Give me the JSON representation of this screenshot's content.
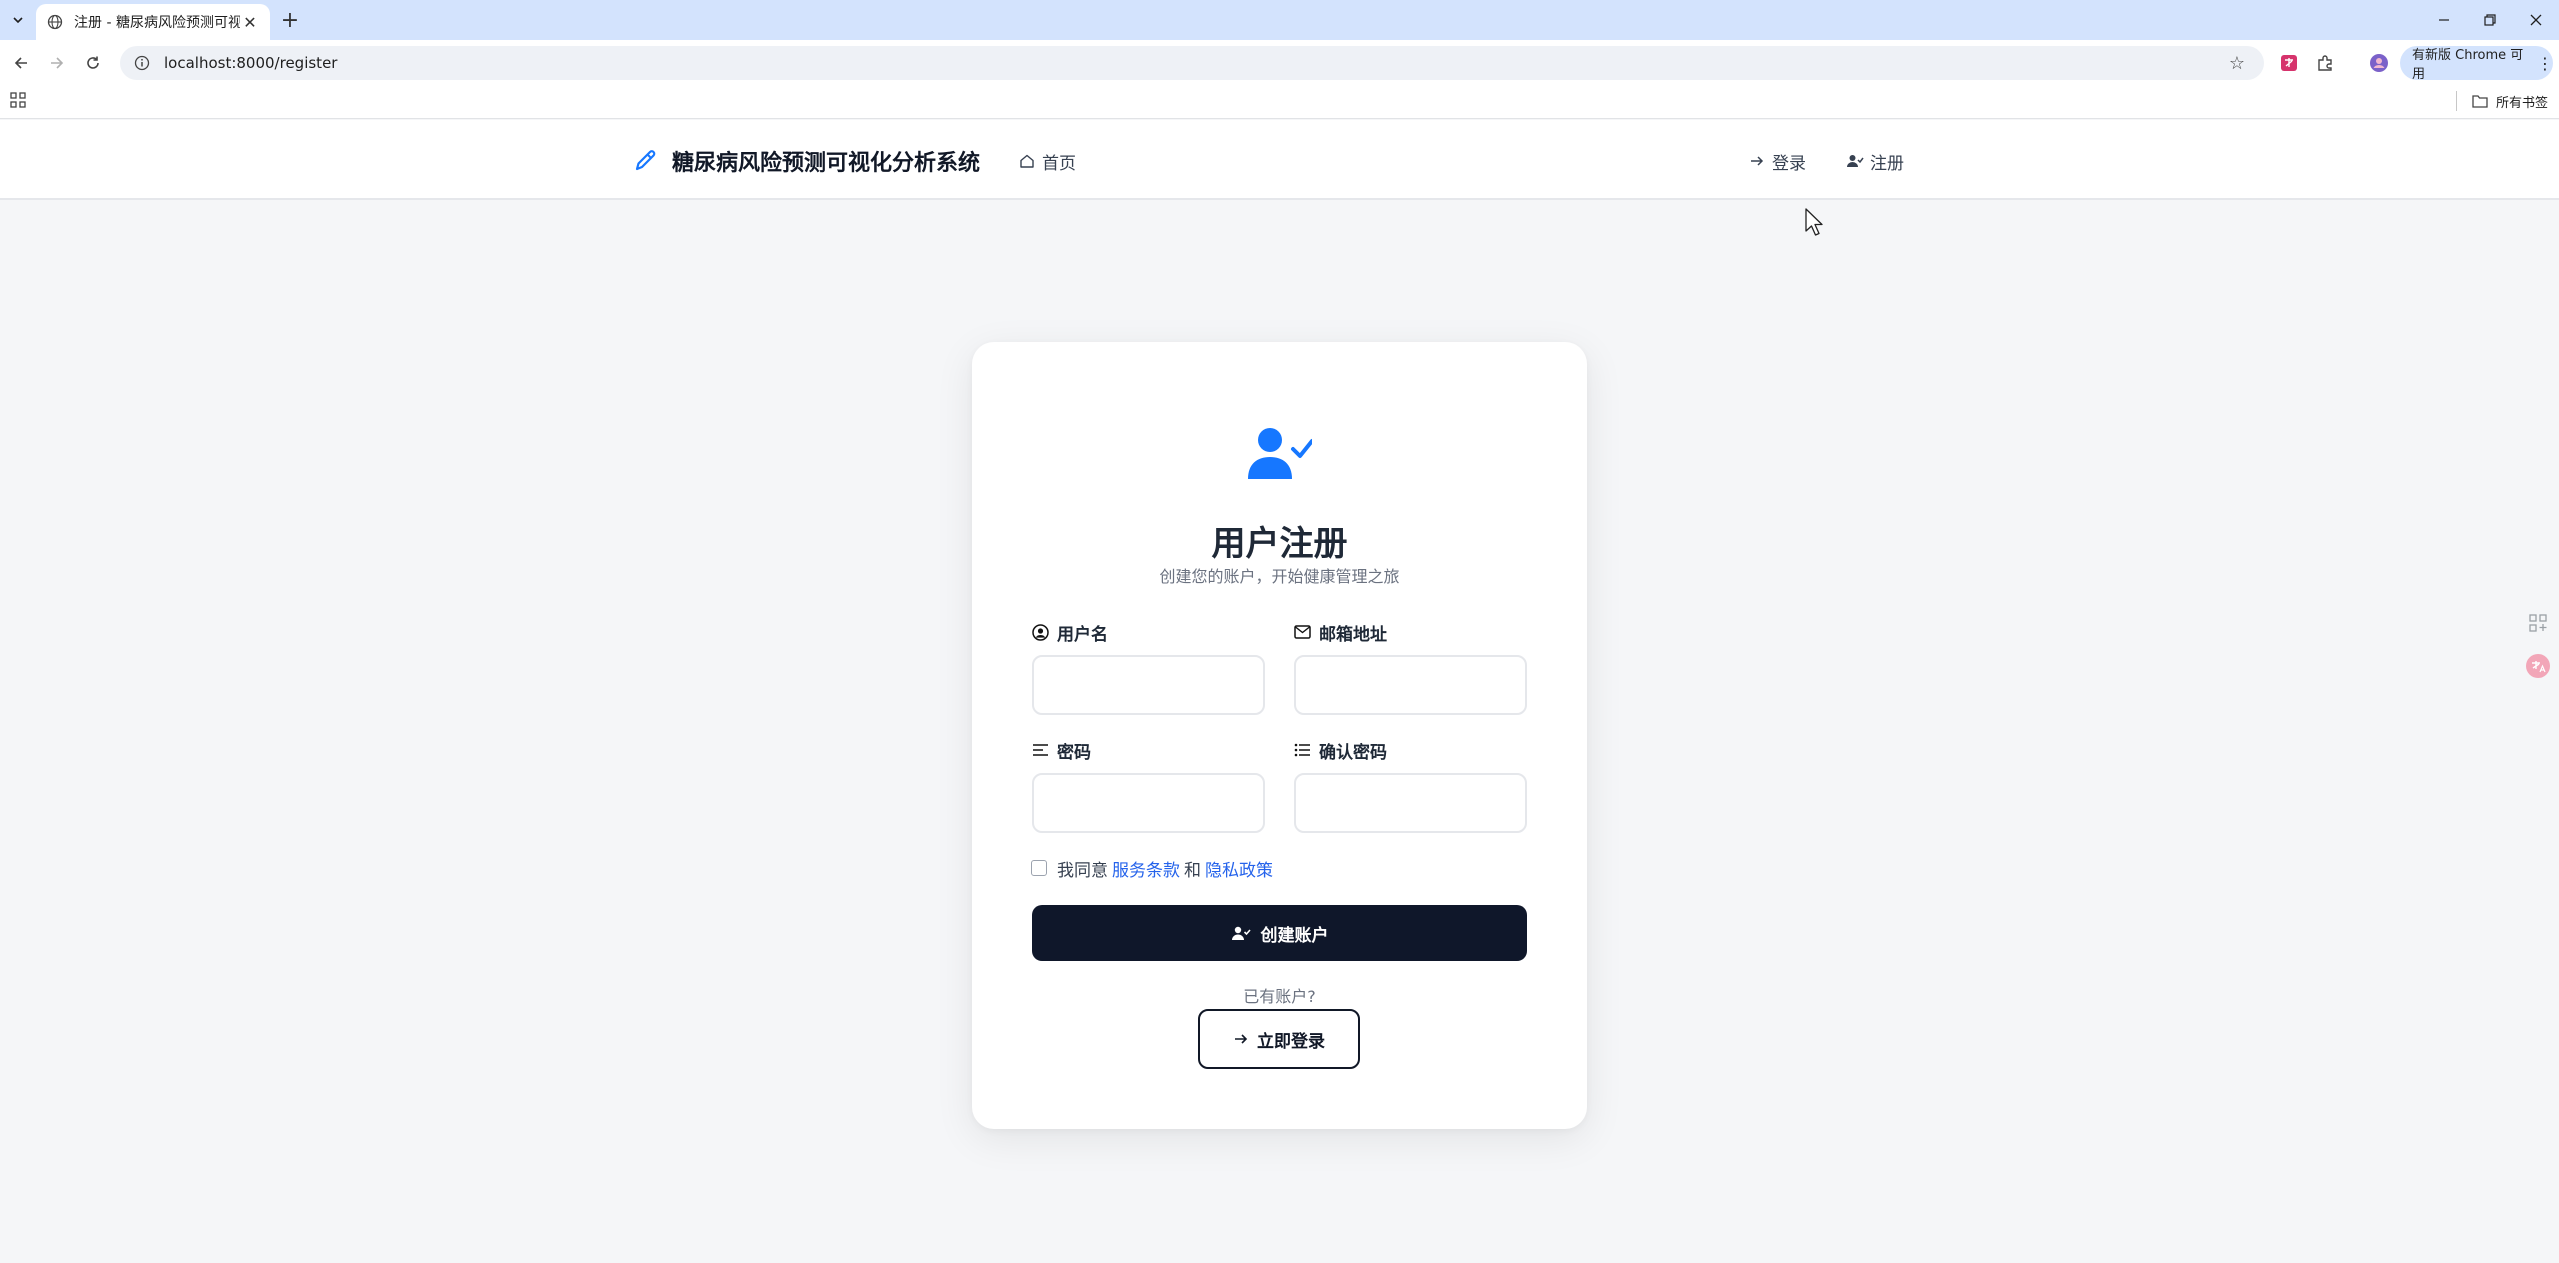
{
  "browser": {
    "tab_title": "注册 - 糖尿病风险预测可视化系统",
    "url": "localhost:8000/register",
    "update_label": "有新版 Chrome 可用",
    "all_bookmarks": "所有书签"
  },
  "header": {
    "brand": "糖尿病风险预测可视化分析系统",
    "nav_home": "首页",
    "nav_login": "登录",
    "nav_register": "注册"
  },
  "form": {
    "title": "用户注册",
    "subtitle": "创建您的账户，开始健康管理之旅",
    "username_label": "用户名",
    "email_label": "邮箱地址",
    "password_label": "密码",
    "confirm_label": "确认密码",
    "username_value": "",
    "email_value": "",
    "password_value": "",
    "confirm_value": "",
    "agree_prefix": "我同意",
    "terms_link": "服务条款",
    "and_text": "和",
    "privacy_link": "隐私政策",
    "agree_checked": false,
    "create_button": "创建账户",
    "have_account": "已有账户?",
    "login_button": "立即登录"
  },
  "colors": {
    "accent": "#1677ff",
    "button_dark": "#0f172a",
    "link": "#2563eb",
    "page_bg": "#f5f6f8"
  }
}
